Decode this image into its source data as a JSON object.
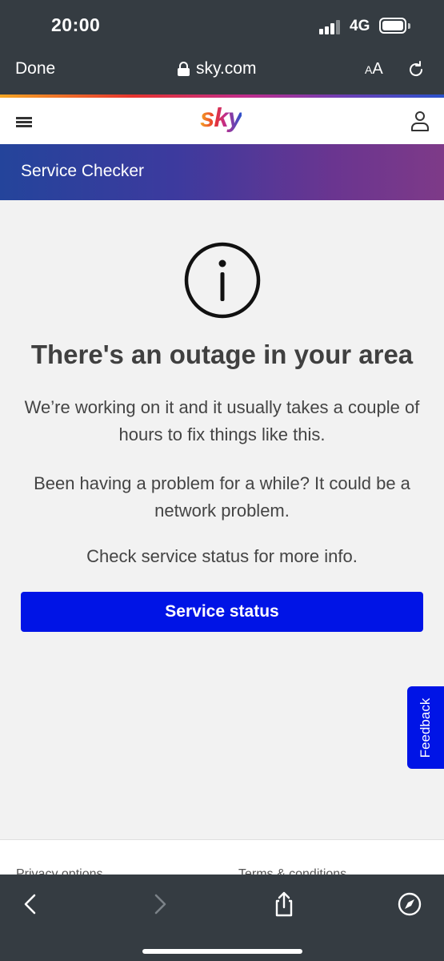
{
  "status_bar": {
    "time": "20:00",
    "network": "4G",
    "icons": [
      "signal-icon",
      "battery-icon"
    ]
  },
  "browser": {
    "done_label": "Done",
    "url": "sky.com",
    "text_size_label": "AA",
    "icons": [
      "lock-icon",
      "reload-icon",
      "back-icon",
      "forward-icon",
      "share-icon",
      "compass-icon"
    ]
  },
  "header": {
    "logo": "sky",
    "icons": [
      "hamburger-menu-icon",
      "account-icon"
    ]
  },
  "banner": {
    "title": "Service Checker"
  },
  "main": {
    "icon": "info-icon",
    "headline": "There's an outage in your area",
    "paragraph_1": "We’re working on it and it usually takes a couple of hours to fix things like this.",
    "paragraph_2": "Been having a problem for a while? It could be a network problem.",
    "paragraph_3": "Check service status for more info.",
    "button_label": "Service status"
  },
  "feedback": {
    "label": "Feedback"
  },
  "footer": {
    "links": [
      "Privacy options",
      "Terms & conditions"
    ]
  },
  "colors": {
    "accent_blue": "#0014e6",
    "chrome_dark": "#353c42",
    "banner_start": "#24449b",
    "banner_end": "#7e3a88"
  }
}
